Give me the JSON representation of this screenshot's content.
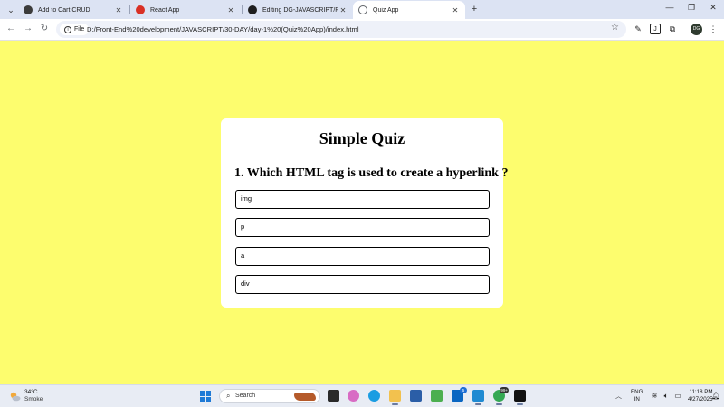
{
  "browser": {
    "tabs": [
      {
        "title": "Add to Cart CRUD",
        "active": false,
        "favicon_color": "#3c3c3c"
      },
      {
        "title": "React App",
        "active": false,
        "favicon_color": "#d93025"
      },
      {
        "title": "Editing DG-JAVASCRIPT/READM",
        "active": false,
        "favicon_color": "#1f1f1f"
      },
      {
        "title": "Quiz App",
        "active": true,
        "favicon_color": "#5f6368"
      }
    ],
    "new_tab_symbol": "+",
    "site_info_label": "File",
    "url": "D:/Front-End%20development/JAVASCRIPT/30-DAY/day-1%20(Quiz%20App)/index.html"
  },
  "quiz": {
    "title": "Simple Quiz",
    "question": "1. Which HTML tag is used to create a hyperlink ?",
    "answers": [
      "img",
      "p",
      "a",
      "div"
    ]
  },
  "taskbar": {
    "weather": {
      "temp": "34°C",
      "condition": "Smoke"
    },
    "search_label": "Search",
    "linkedin_badge": "5",
    "chrome_badge": "99+",
    "language": {
      "line1": "ENG",
      "line2": "IN"
    },
    "clock": {
      "time": "11:18 PM",
      "date": "4/27/2025"
    }
  },
  "colors": {
    "page_background": "#fdfd6e",
    "card_background": "#ffffff",
    "tabstrip": "#dce3f3"
  }
}
